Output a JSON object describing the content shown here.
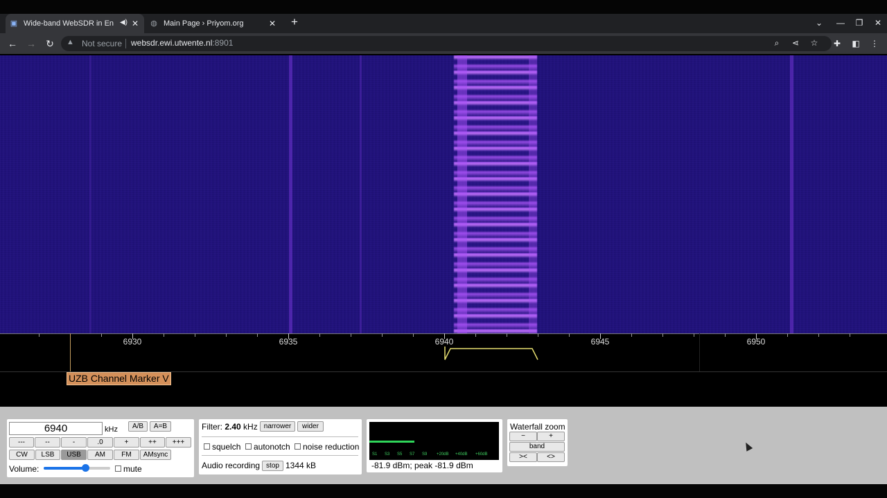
{
  "browser": {
    "tabs": [
      {
        "title": "Wide-band WebSDR in Ensch",
        "active": true,
        "audio": true
      },
      {
        "title": "Main Page › Priyom.org",
        "active": false
      }
    ],
    "url_host": "websdr.ewi.utwente.nl",
    "url_port": ":8901",
    "security_text": "Not secure"
  },
  "scale": {
    "ticks": [
      "6930",
      "6935",
      "6940",
      "6945",
      "6950"
    ]
  },
  "marker_label": "UZB Channel Marker V",
  "frequency_panel": {
    "freq_value": "6940",
    "unit": "kHz",
    "ab_label": "A/B",
    "aeqb_label": "A=B",
    "step_buttons": [
      "---",
      "--",
      "-",
      ".0",
      "+",
      "++",
      "+++"
    ],
    "mode_buttons": [
      "CW",
      "LSB",
      "USB",
      "AM",
      "FM",
      "AMsync"
    ],
    "active_mode": "USB",
    "volume_label": "Volume:",
    "volume_level": 0.62,
    "mute_label": "mute"
  },
  "filter_panel": {
    "filter_label": "Filter:",
    "filter_value": "2.40",
    "filter_unit": "kHz",
    "narrower_label": "narrower",
    "wider_label": "wider",
    "squelch_label": "squelch",
    "autonotch_label": "autonotch",
    "noise_reduction_label": "noise reduction",
    "recording_label": "Audio recording",
    "stop_label": "stop",
    "recording_size": "1344 kB"
  },
  "smeter_panel": {
    "scale_labels": [
      "S1",
      "S3",
      "S5",
      "S7",
      "S9",
      "+20dB",
      "+40dB",
      "+60dB"
    ],
    "level_fraction": 0.35,
    "reading": "-81.9 dBm; peak  -81.9 dBm"
  },
  "zoom_panel": {
    "title": "Waterfall zoom",
    "minus_label": "−",
    "plus_label": "+",
    "band_label": "band",
    "in_label": "><",
    "out_label": "<>"
  },
  "colors": {
    "waterfall_bg": "#1a0e6e",
    "signal": "#b45aff",
    "marker_bg": "#d4905a",
    "control_bg": "#c0c0c0"
  }
}
